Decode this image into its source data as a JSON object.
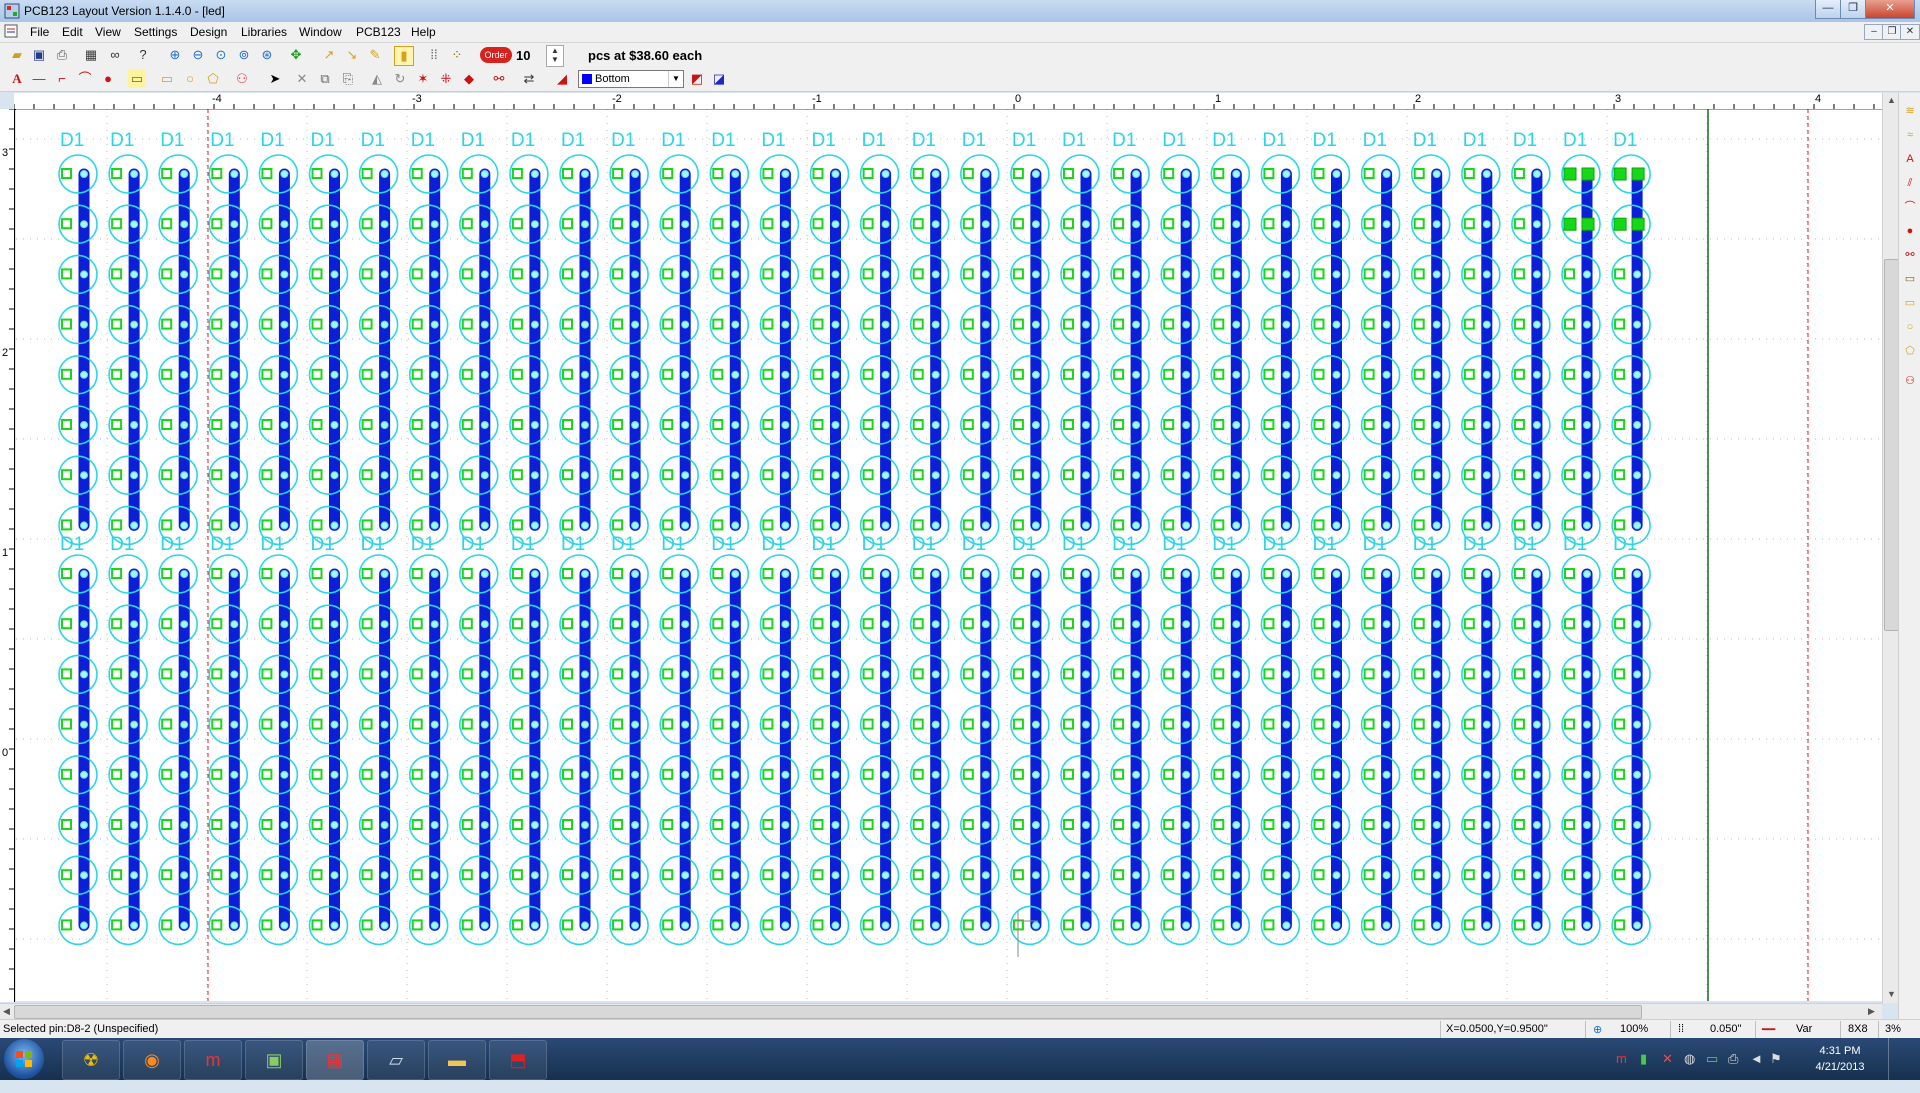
{
  "window": {
    "title": "PCB123 Layout Version 1.1.4.0 - [led]",
    "controls": [
      "—",
      "❐",
      "✕"
    ]
  },
  "menu": {
    "items": [
      "File",
      "Edit",
      "View",
      "Settings",
      "Design",
      "Libraries",
      "Window",
      "PCB123",
      "Help"
    ],
    "mdi_controls": [
      "–",
      "❐",
      "✕"
    ]
  },
  "toolbar": {
    "order_label": "Order",
    "order_qty": "10",
    "price_text": "pcs at $38.60 each",
    "layer_select": "Bottom",
    "layer_color": "#0000ff"
  },
  "ruler": {
    "top_labels": [
      "-4",
      "-3",
      "-2",
      "-1",
      "0",
      "1",
      "2",
      "3",
      "4"
    ],
    "left_labels": [
      "3",
      "2",
      "1",
      "0"
    ]
  },
  "board": {
    "designator": "D1",
    "columns": 32,
    "rows_per_block": 8,
    "blocks": 2,
    "trace_color": "#0b1fd6",
    "outline_color": "#2ad6e6",
    "pad_color": "#18d618",
    "highlight_color": "#18d618"
  },
  "status": {
    "selected": "Selected pin:D8-2 (Unspecified)",
    "coords": "X=0.0500,Y=0.9500\"",
    "zoom": "100%",
    "grid": "0.050\"",
    "trace": "Var",
    "size": "8X8",
    "percent": "3%"
  },
  "taskbar": {
    "time": "4:31 PM",
    "date": "4/21/2013"
  }
}
